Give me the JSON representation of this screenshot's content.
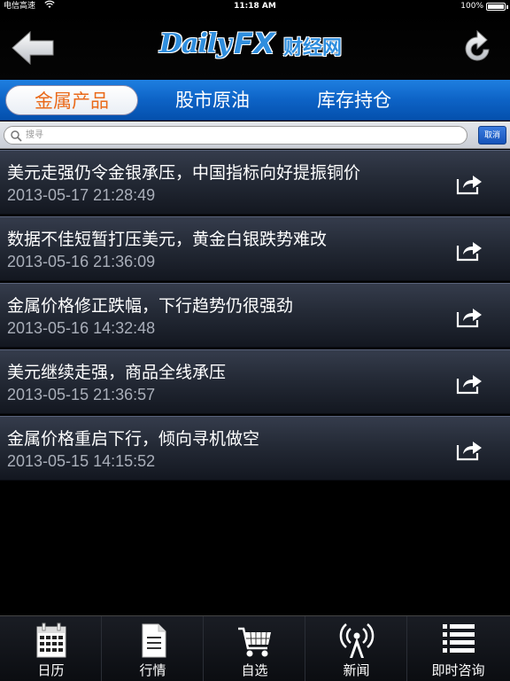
{
  "status_bar": {
    "carrier": "电信高速",
    "time": "11:18 AM",
    "battery": "100%"
  },
  "header": {
    "logo_daily": "Daily",
    "logo_fx": "FX",
    "logo_cn": "财经网"
  },
  "tabs": [
    {
      "label": "金属产品",
      "active": true
    },
    {
      "label": "股市原油",
      "active": false
    },
    {
      "label": "库存持仓",
      "active": false
    }
  ],
  "search": {
    "placeholder": "搜寻",
    "cancel_label": "取消"
  },
  "news": [
    {
      "title": "美元走强仍令金银承压，中国指标向好提振铜价",
      "date": "2013-05-17 21:28:49"
    },
    {
      "title": "数据不佳短暂打压美元，黄金白银跌势难改",
      "date": "2013-05-16 21:36:09"
    },
    {
      "title": "金属价格修正跌幅，下行趋势仍很强劲",
      "date": "2013-05-16 14:32:48"
    },
    {
      "title": "美元继续走强，商品全线承压",
      "date": "2013-05-15 21:36:57"
    },
    {
      "title": "金属价格重启下行，倾向寻机做空",
      "date": "2013-05-15 14:15:52"
    }
  ],
  "bottom_nav": [
    {
      "label": "日历",
      "icon": "calendar-icon"
    },
    {
      "label": "行情",
      "icon": "document-icon"
    },
    {
      "label": "自选",
      "icon": "cart-icon"
    },
    {
      "label": "新闻",
      "icon": "antenna-icon"
    },
    {
      "label": "即时咨询",
      "icon": "list-icon"
    }
  ],
  "colors": {
    "tab_bar": "#0d63c6",
    "active_tab_text": "#ea6a1a",
    "logo_blue": "#2f8ede",
    "date_text": "#a9aeb9"
  }
}
